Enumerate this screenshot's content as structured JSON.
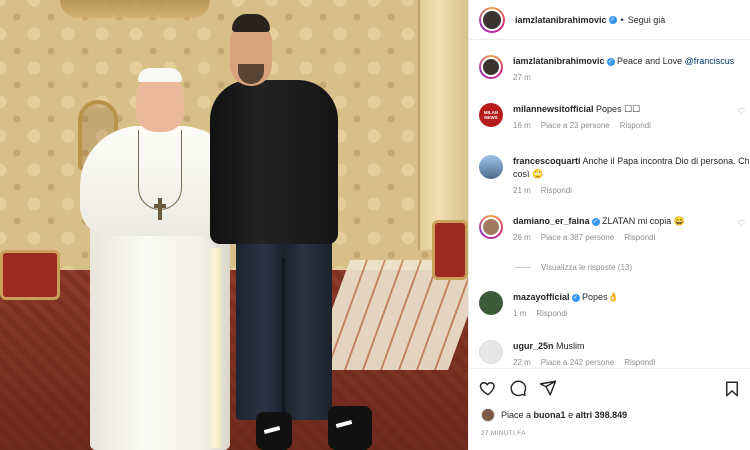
{
  "post_header": {
    "username": "iamzlatanibrahimovic",
    "separator": "•",
    "follow_label": "Segui già"
  },
  "caption": {
    "username": "iamzlatanibrahimovic",
    "text": "Peace and Love",
    "mention": "@franciscus",
    "time": "27 m"
  },
  "comments": [
    {
      "username": "milannewsitofficial",
      "text": "Popes ☐☐",
      "time": "16 m",
      "likes": "Piace a 23 persone",
      "reply": "Rispondi",
      "avatar_text": "MILAN NEWS",
      "avatar_color": "#b71c1c",
      "verified": false
    },
    {
      "username": "francescoquarti",
      "text": "Anche il Papa incontra Dio di persona. Che è",
      "text2": "così 🙄",
      "time": "21 m",
      "likes": "",
      "reply": "Rispondi",
      "avatar_text": "",
      "avatar_color": "#6b8bb5",
      "verified": false
    },
    {
      "username": "damiano_er_faina",
      "text": "ZLATAN mi copia 😄",
      "time": "26 m",
      "likes": "Piace a 387 persone",
      "reply": "Rispondi",
      "avatar_text": "",
      "avatar_color": "#a07a5e",
      "verified": true
    },
    {
      "username": "mazayofficial",
      "text": "Popes👌",
      "time": "1 m",
      "likes": "",
      "reply": "Rispondi",
      "avatar_text": "",
      "avatar_color": "#3d5a3a",
      "verified": true
    },
    {
      "username": "ugur_25n",
      "text": "Muslim",
      "time": "22 m",
      "likes": "Piace a 242 persone",
      "reply": "Rispondi",
      "avatar_text": "",
      "avatar_color": "#e0e0e0",
      "verified": false
    }
  ],
  "view_replies": "Visualizza le risposte (13)",
  "likes": {
    "prefix": "Piace a",
    "user": "buona1",
    "middle": "e",
    "others": "altri 398.849"
  },
  "timestamp": "27 MINUTI FA",
  "icons": {
    "like": "heart-icon",
    "comment": "comment-icon",
    "share": "share-icon",
    "save": "bookmark-icon",
    "verified": "verified-badge-icon"
  },
  "colors": {
    "verified": "#3897f0",
    "mention": "#00376b",
    "secondary_text": "#8e8e8e"
  }
}
